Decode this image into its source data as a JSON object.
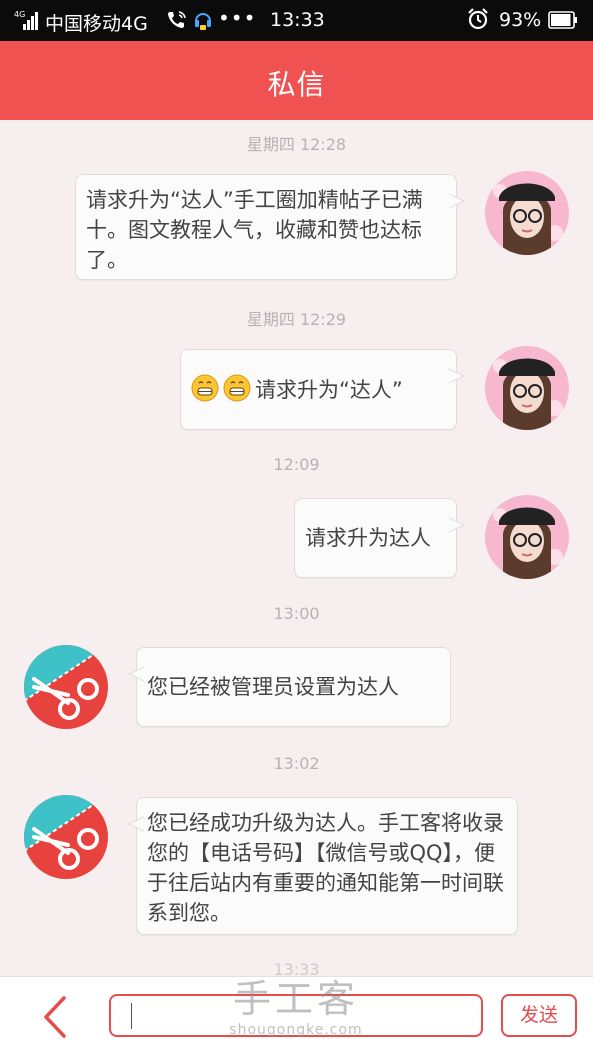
{
  "status_bar": {
    "network_label": "4G",
    "carrier": "中国移动4G",
    "call_icon": "phone-wifi-icon",
    "extra": "•••",
    "time": "13:33",
    "battery_percent": "93%",
    "battery_level": 0.93
  },
  "header": {
    "title": "私信"
  },
  "messages": [
    {
      "timestamp": "星期四 12:28",
      "side": "right",
      "text": "请求升为“达人”手工圈加精帖子已满十。图文教程人气，收藏和赞也达标了。"
    },
    {
      "timestamp": "星期四 12:29",
      "side": "right",
      "emoji_count": 2,
      "text": "请求升为“达人”"
    },
    {
      "timestamp": "12:09",
      "side": "right",
      "text": "请求升为达人"
    },
    {
      "timestamp": "13:00",
      "side": "left",
      "text": "您已经被管理员设置为达人"
    },
    {
      "timestamp": "13:02",
      "side": "left",
      "text": "您已经成功升级为达人。手工客将收录您的【电话号码】【微信号或QQ】，便于往后站内有重要的通知能第一时间联系到您。"
    }
  ],
  "partial_timestamp": "13:33",
  "composer": {
    "input_value": "",
    "send_label": "发送"
  },
  "watermark": {
    "big": "手工客",
    "small": "shougongke.com"
  },
  "colors": {
    "accent": "#f05252",
    "button_border": "#e34d4d",
    "background": "#f6eeef"
  }
}
